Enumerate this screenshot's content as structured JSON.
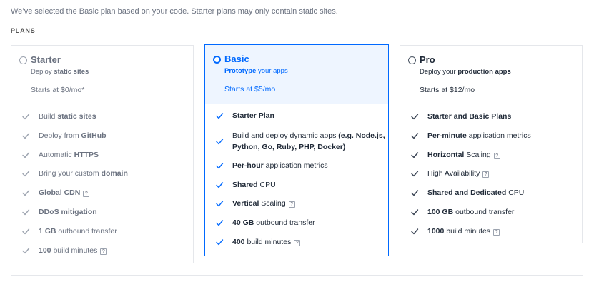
{
  "intro": "We’ve selected the Basic plan based on your code. Starter plans may only contain static sites.",
  "plans_label": "PLANS",
  "colors": {
    "accent": "#0069ff",
    "muted": "#6b7280",
    "dark": "#1f2937"
  },
  "plans": [
    {
      "name": "Starter",
      "tag_pre": "Deploy ",
      "tag_bold": "static sites",
      "tag_post": "",
      "price": "Starts at $0/mo*",
      "features": [
        {
          "pre": "Build ",
          "bold": "static sites",
          "post": "",
          "help": false
        },
        {
          "pre": "Deploy from ",
          "bold": "GitHub",
          "post": "",
          "help": false
        },
        {
          "pre": "Automatic ",
          "bold": "HTTPS",
          "post": "",
          "help": false
        },
        {
          "pre": "Bring your custom ",
          "bold": "domain",
          "post": "",
          "help": false
        },
        {
          "pre": "",
          "bold": "Global CDN",
          "post": "",
          "help": true
        },
        {
          "pre": "",
          "bold": "DDoS mitigation",
          "post": "",
          "help": false
        },
        {
          "pre": "",
          "bold": "1 GB",
          "post": " outbound transfer",
          "help": false
        },
        {
          "pre": "",
          "bold": "100",
          "post": " build minutes",
          "help": true
        }
      ]
    },
    {
      "name": "Basic",
      "tag_pre": "",
      "tag_bold": "Prototype",
      "tag_post": " your apps",
      "price": "Starts at $5/mo",
      "features": [
        {
          "pre": "",
          "bold": "Starter Plan",
          "post": "",
          "help": false
        },
        {
          "pre": "Build and deploy dynamic apps ",
          "bold": "(e.g. Node.js, Python, Go, Ruby, PHP, Docker)",
          "post": "",
          "help": false,
          "two": true
        },
        {
          "pre": "",
          "bold": "Per-hour",
          "post": " application metrics",
          "help": false
        },
        {
          "pre": "",
          "bold": "Shared",
          "post": " CPU",
          "help": false
        },
        {
          "pre": "",
          "bold": "Vertical",
          "post": " Scaling",
          "help": true
        },
        {
          "pre": "",
          "bold": "40 GB",
          "post": " outbound transfer",
          "help": false
        },
        {
          "pre": "",
          "bold": "400",
          "post": " build minutes",
          "help": true
        }
      ]
    },
    {
      "name": "Pro",
      "tag_pre": "Deploy your ",
      "tag_bold": "production apps",
      "tag_post": "",
      "price": "Starts at $12/mo",
      "features": [
        {
          "pre": "",
          "bold": "Starter and Basic Plans",
          "post": "",
          "help": false
        },
        {
          "pre": "",
          "bold": "Per-minute",
          "post": " application metrics",
          "help": false
        },
        {
          "pre": "",
          "bold": "Horizontal",
          "post": " Scaling",
          "help": true
        },
        {
          "pre": "High Availability",
          "bold": "",
          "post": "",
          "help": true
        },
        {
          "pre": "",
          "bold": "Shared and Dedicated",
          "post": " CPU",
          "help": false
        },
        {
          "pre": "",
          "bold": "100 GB",
          "post": " outbound transfer",
          "help": false
        },
        {
          "pre": "",
          "bold": "1000",
          "post": " build minutes",
          "help": true
        }
      ]
    }
  ],
  "help_glyph": "?"
}
